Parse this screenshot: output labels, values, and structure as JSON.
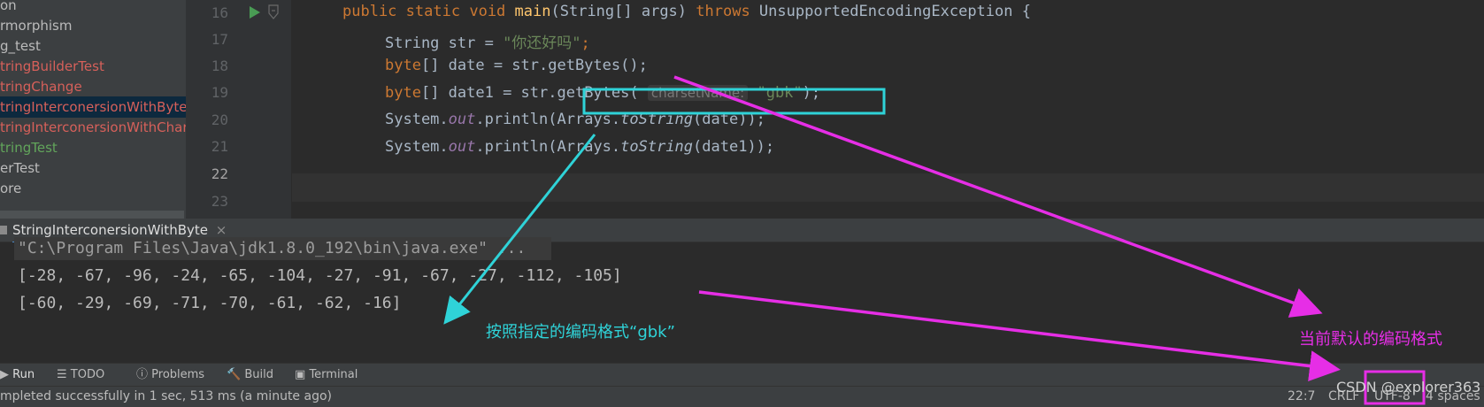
{
  "project_tree": {
    "items": [
      {
        "label": "on",
        "color": "#bbbbbb",
        "selected": false
      },
      {
        "label": "rmorphism",
        "color": "#bbbbbb",
        "selected": false
      },
      {
        "label": "g_test",
        "color": "#bbbbbb",
        "selected": false
      },
      {
        "label": "tringBuilderTest",
        "color": "#d6605a",
        "selected": false
      },
      {
        "label": "tringChange",
        "color": "#d6605a",
        "selected": false
      },
      {
        "label": "tringInterconersionWithByte",
        "color": "#d6605a",
        "selected": true
      },
      {
        "label": "tringInterconersionWithChar",
        "color": "#d6605a",
        "selected": false
      },
      {
        "label": "tringTest",
        "color": "#62a55b",
        "selected": false
      },
      {
        "label": "erTest",
        "color": "#bbbbbb",
        "selected": false
      },
      {
        "label": "ore",
        "color": "#bbbbbb",
        "selected": false
      }
    ]
  },
  "editor": {
    "line_numbers": [
      "16",
      "17",
      "18",
      "19",
      "20",
      "21",
      "22",
      "23"
    ],
    "line16": {
      "public": "public",
      "static": "static",
      "void": "void",
      "main": "main",
      "args_open": "(String[] args) ",
      "throws": "throws",
      "exception": " UnsupportedEncodingException {"
    },
    "line17": {
      "type": "String str = ",
      "literal": "\"你还好吗\"",
      "end": ";"
    },
    "line18": {
      "byte": "byte",
      "rest": "[] date = str.getBytes();"
    },
    "line19": {
      "byte": "byte",
      "rest": "[] date1 = str.",
      "call": "getBytes(",
      "hint": "charsetName:",
      "literal": "\"gbk\"",
      "end": ");"
    },
    "line20": {
      "a": "System.",
      "out": "out",
      "b": ".println(Arrays.",
      "tostring": "toString",
      "c": "(date));"
    },
    "line21": {
      "a": "System.",
      "out": "out",
      "b": ".println(Arrays.",
      "tostring": "toString",
      "c": "(date1));"
    }
  },
  "run_tab": {
    "label": "StringInterconersionWithByte",
    "close": "×"
  },
  "console": {
    "command": "\"C:\\Program Files\\Java\\jdk1.8.0_192\\bin\\java.exe\" ...",
    "output1": "[-28, -67, -96, -24, -65, -104, -27, -91, -67, -27, -112, -105]",
    "output2": "[-60, -29, -69, -71, -70, -61, -62, -16]"
  },
  "tool_windows": [
    {
      "label": "Run",
      "icon": "run-icon"
    },
    {
      "label": "TODO",
      "icon": "todo-icon"
    },
    {
      "label": "Problems",
      "icon": "problems-icon"
    },
    {
      "label": "Build",
      "icon": "build-icon"
    },
    {
      "label": "Terminal",
      "icon": "terminal-icon"
    }
  ],
  "status": {
    "message": "mpleted successfully in 1 sec, 513 ms (a minute ago)",
    "position": "22:7",
    "line_sep": "CRLF",
    "encoding": "UTF-8",
    "indent": "4 spaces"
  },
  "annotations": {
    "cyan_label": "按照指定的编码格式“gbk”",
    "magenta_label": "当前默认的编码格式",
    "watermark": "CSDN @explorer363",
    "cyan_color": "#2fd3d8",
    "magenta_color": "#e62ee6"
  }
}
